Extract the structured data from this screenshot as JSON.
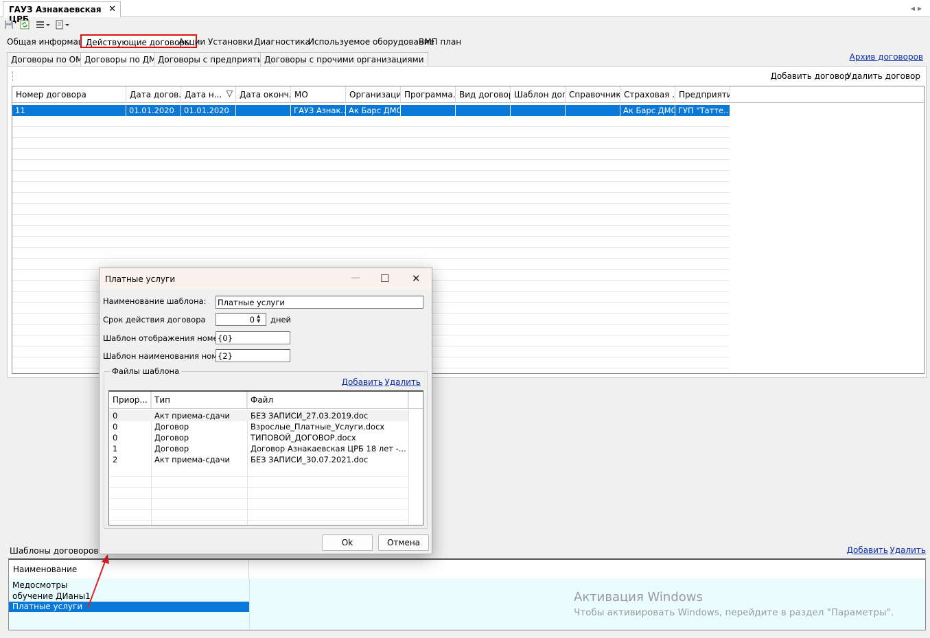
{
  "doc_tab": {
    "title": "ГАУЗ Азнакаевская ЦРБ",
    "close": "✕"
  },
  "main_tabs": [
    "Общая информация",
    "Действующие договоры",
    "Акции",
    "Установки",
    "Диагностика",
    "Используемое оборудование",
    "ВМП план"
  ],
  "sub_tabs": [
    "Договоры по ОМС",
    "Договоры по ДМС",
    "Договоры с предприятиями",
    "Договоры с прочими организациями"
  ],
  "archive_link": "Архив договоров",
  "contract_toolbar": {
    "add": "Добавить договор",
    "delete": "Удалить договор"
  },
  "contracts_grid": {
    "columns": [
      "Номер договора",
      "Дата догов...",
      "Дата н...",
      "Дата оконч...",
      "МО",
      "Организация",
      "Программа...",
      "Вид договора",
      "Шаблон дог...",
      "Справочник...",
      "Страховая ...",
      "Предприятие"
    ],
    "rows": [
      [
        "11",
        "01.01.2020",
        "01.01.2020",
        "",
        "ГАУЗ Азнак...",
        "Ак Барс ДМС",
        "",
        "",
        "",
        "",
        "Ак Барс ДМС",
        "ГУП \"Татте..."
      ]
    ]
  },
  "templates": {
    "title": "Шаблоны договоров",
    "add": "Добавить",
    "delete": "Удалить",
    "column": "Наименование",
    "rows": [
      "Медосмотры",
      "обучение ДИаны1",
      "Платные услуги"
    ],
    "selected_index": 2
  },
  "watermark": {
    "line1": "Активация Windows",
    "line2": "Чтобы активировать Windows, перейдите в раздел \"Параметры\"."
  },
  "dialog": {
    "title": "Платные услуги",
    "fields": {
      "name_label": "Наименование шаблона:",
      "name_value": "Платные услуги",
      "term_label": "Срок действия договора",
      "term_value": "0",
      "term_unit": "дней",
      "display_label": "Шаблон отображения номера:",
      "display_value": "{0}",
      "naming_label": "Шаблон наименования номера:",
      "naming_value": "{2}"
    },
    "files": {
      "title": "Файлы шаблона",
      "add": "Добавить",
      "delete": "Удалить",
      "columns": [
        "Приор...",
        "Тип",
        "Файл"
      ],
      "rows": [
        [
          "0",
          "Акт приема-сдачи",
          "БЕЗ ЗАПИСИ_27.03.2019.doc"
        ],
        [
          "0",
          "Договор",
          "Взрослые_Платные_Услуги.docx"
        ],
        [
          "0",
          "Договор",
          "ТИПОВОЙ_ДОГОВОР.docx"
        ],
        [
          "1",
          "Договор",
          "Договор Азнакаевская ЦРБ 18 лет -..."
        ],
        [
          "2",
          "Акт приема-сдачи",
          "БЕЗ ЗАПИСИ_30.07.2021.doc"
        ]
      ]
    },
    "ok": "Ok",
    "cancel": "Отмена"
  },
  "colors": {
    "selection": "#0a78d7",
    "link": "#0b2fa8",
    "highlight_border": "#dd1111",
    "annotation_arrow": "#e3202a"
  }
}
